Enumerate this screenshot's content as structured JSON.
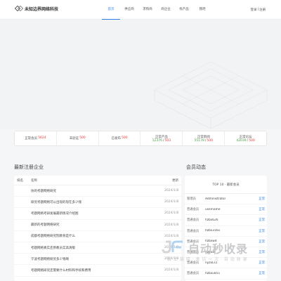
{
  "header": {
    "brand": "未知边界网络科技",
    "nav": [
      "首页",
      "供应商",
      "求购商",
      "商企业",
      "找产品",
      "我吧"
    ],
    "login": "登录",
    "separator": "|",
    "register": "注册"
  },
  "stats": [
    {
      "label": "正常会员",
      "value": "5624"
    },
    {
      "label": "未验证",
      "value": "500"
    },
    {
      "label": "已发布",
      "value": "500"
    },
    {
      "label": "正常产品",
      "value_green": "12376",
      "sep": "/",
      "value": "503"
    },
    {
      "label": "正常新闻",
      "value_green": "55178",
      "sep": "/",
      "value": "500"
    },
    {
      "label": "正常论坛",
      "value_green": "42039",
      "sep": "/",
      "value": "500"
    }
  ],
  "latest": {
    "title": "最新注册企业",
    "columns": [
      "排名",
      "名称",
      "更新"
    ],
    "rows": [
      {
        "idx": "",
        "name": "协的考题网络研究",
        "date": "2024/1/8"
      },
      {
        "idx": "",
        "name": "研究考题网络可以出现的现在多少钱",
        "date": "2024/1/8"
      },
      {
        "idx": "",
        "name": "考题网络考研发展最新情况介绍图",
        "date": "2024/1/8"
      },
      {
        "idx": "",
        "name": "最新的考题网络研究",
        "date": "2024/1/8"
      },
      {
        "idx": "",
        "name": "成都考题网络研究院教育是什么",
        "date": "2024/1/8"
      },
      {
        "idx": "",
        "name": "考题网络真实还原教员实高清版",
        "date": "2024/1/8"
      },
      {
        "idx": "",
        "name": "宁波考题网络研究多少钱啊",
        "date": "2024/1/8"
      },
      {
        "idx": "",
        "name": "考题网络研究还需要什么材料和手续和费用",
        "date": "2024/1/8"
      }
    ]
  },
  "members": {
    "title": "会员动态",
    "header": "TOP 10 · 最新会员",
    "rows": [
      {
        "level": "管理员",
        "user": "Administrator",
        "action": "正常"
      },
      {
        "level": "普通会员",
        "user": "username",
        "action": "正常"
      },
      {
        "level": "普通会员",
        "user": "hzbx626",
        "action": "正常"
      },
      {
        "level": "普通会员",
        "user": "hzbx316x",
        "action": "正常"
      },
      {
        "level": "普通会员",
        "user": "hzbxwd",
        "action": "正常"
      },
      {
        "level": "普通会员",
        "user": "hzbx8",
        "action": "正常"
      },
      {
        "level": "普通会员",
        "user": "nyzxLs1",
        "action": "正常"
      },
      {
        "level": "普通会员",
        "user": "hzbxu851",
        "action": "正常"
      }
    ]
  },
  "watermark": {
    "title": "自动秒收录",
    "subtitle": "数 上 链 接 · 来 访 一 次 · 自 动 收 录"
  }
}
